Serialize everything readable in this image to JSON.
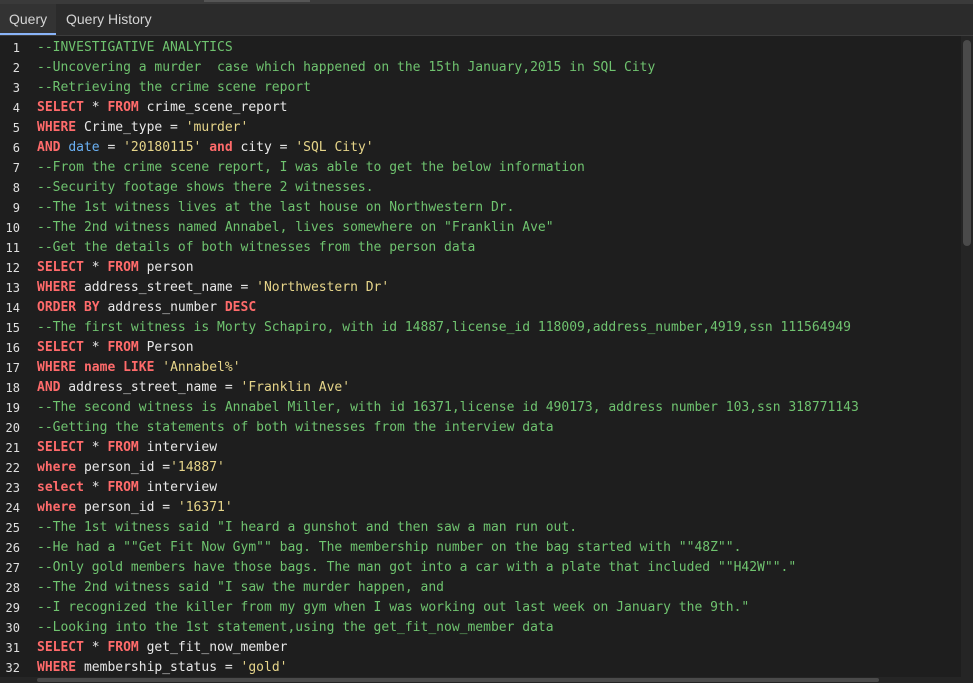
{
  "tabs": [
    {
      "label": "Query",
      "active": true
    },
    {
      "label": "Query History",
      "active": false
    }
  ],
  "colors": {
    "background": "#1e1e1e",
    "comment": "#6fc36f",
    "keyword": "#ff6b6b",
    "string": "#e6d58a",
    "plain": "#e8e8e8",
    "function": "#6ab0f3"
  },
  "lines": [
    [
      [
        "comment",
        "--INVESTIGATIVE ANALYTICS"
      ]
    ],
    [
      [
        "comment",
        "--Uncovering a murder  case which happened on the 15th January,2015 in SQL City"
      ]
    ],
    [
      [
        "comment",
        "--Retrieving the crime scene report"
      ]
    ],
    [
      [
        "keyword",
        "SELECT"
      ],
      [
        "plain",
        " * "
      ],
      [
        "keyword",
        "FROM"
      ],
      [
        "plain",
        " crime_scene_report"
      ]
    ],
    [
      [
        "keyword",
        "WHERE"
      ],
      [
        "plain",
        " Crime_type = "
      ],
      [
        "string",
        "'murder'"
      ]
    ],
    [
      [
        "keyword",
        "AND"
      ],
      [
        "plain",
        " "
      ],
      [
        "func",
        "date"
      ],
      [
        "plain",
        " = "
      ],
      [
        "string",
        "'20180115'"
      ],
      [
        "plain",
        " "
      ],
      [
        "keyword",
        "and"
      ],
      [
        "plain",
        " city = "
      ],
      [
        "string",
        "'SQL City'"
      ]
    ],
    [
      [
        "comment",
        "--From the crime scene report, I was able to get the below information"
      ]
    ],
    [
      [
        "comment",
        "--Security footage shows there 2 witnesses."
      ]
    ],
    [
      [
        "comment",
        "--The 1st witness lives at the last house on Northwestern Dr."
      ]
    ],
    [
      [
        "comment",
        "--The 2nd witness named Annabel, lives somewhere on \"Franklin Ave\""
      ]
    ],
    [
      [
        "comment",
        "--Get the details of both witnesses from the person data"
      ]
    ],
    [
      [
        "keyword",
        "SELECT"
      ],
      [
        "plain",
        " * "
      ],
      [
        "keyword",
        "FROM"
      ],
      [
        "plain",
        " person"
      ]
    ],
    [
      [
        "keyword",
        "WHERE"
      ],
      [
        "plain",
        " address_street_name = "
      ],
      [
        "string",
        "'Northwestern Dr'"
      ]
    ],
    [
      [
        "keyword",
        "ORDER BY"
      ],
      [
        "plain",
        " address_number "
      ],
      [
        "keyword",
        "DESC"
      ]
    ],
    [
      [
        "comment",
        "--The first witness is Morty Schapiro, with id 14887,license_id 118009,address_number,4919,ssn 111564949"
      ]
    ],
    [
      [
        "keyword",
        "SELECT"
      ],
      [
        "plain",
        " * "
      ],
      [
        "keyword",
        "FROM"
      ],
      [
        "plain",
        " Person"
      ]
    ],
    [
      [
        "keyword",
        "WHERE"
      ],
      [
        "plain",
        " "
      ],
      [
        "keyword",
        "name"
      ],
      [
        "plain",
        " "
      ],
      [
        "keyword",
        "LIKE"
      ],
      [
        "plain",
        " "
      ],
      [
        "string",
        "'Annabel%'"
      ]
    ],
    [
      [
        "keyword",
        "AND"
      ],
      [
        "plain",
        " address_street_name = "
      ],
      [
        "string",
        "'Franklin Ave'"
      ]
    ],
    [
      [
        "comment",
        "--The second witness is Annabel Miller, with id 16371,license id 490173, address number 103,ssn 318771143"
      ]
    ],
    [
      [
        "comment",
        "--Getting the statements of both witnesses from the interview data"
      ]
    ],
    [
      [
        "keyword",
        "SELECT"
      ],
      [
        "plain",
        " * "
      ],
      [
        "keyword",
        "FROM"
      ],
      [
        "plain",
        " interview"
      ]
    ],
    [
      [
        "keyword",
        "where"
      ],
      [
        "plain",
        " person_id ="
      ],
      [
        "string",
        "'14887'"
      ]
    ],
    [
      [
        "keyword",
        "select"
      ],
      [
        "plain",
        " * "
      ],
      [
        "keyword",
        "FROM"
      ],
      [
        "plain",
        " interview"
      ]
    ],
    [
      [
        "keyword",
        "where"
      ],
      [
        "plain",
        " person_id = "
      ],
      [
        "string",
        "'16371'"
      ]
    ],
    [
      [
        "comment",
        "--The 1st witness said \"I heard a gunshot and then saw a man run out."
      ]
    ],
    [
      [
        "comment",
        "--He had a \"\"Get Fit Now Gym\"\" bag. The membership number on the bag started with \"\"48Z\"\"."
      ]
    ],
    [
      [
        "comment",
        "--Only gold members have those bags. The man got into a car with a plate that included \"\"H42W\"\".\""
      ]
    ],
    [
      [
        "comment",
        "--The 2nd witness said \"I saw the murder happen, and"
      ]
    ],
    [
      [
        "comment",
        "--I recognized the killer from my gym when I was working out last week on January the 9th.\""
      ]
    ],
    [
      [
        "comment",
        "--Looking into the 1st statement,using the get_fit_now_member data"
      ]
    ],
    [
      [
        "keyword",
        "SELECT"
      ],
      [
        "plain",
        " * "
      ],
      [
        "keyword",
        "FROM"
      ],
      [
        "plain",
        " get_fit_now_member"
      ]
    ],
    [
      [
        "keyword",
        "WHERE"
      ],
      [
        "plain",
        " membership_status = "
      ],
      [
        "string",
        "'gold'"
      ]
    ]
  ]
}
